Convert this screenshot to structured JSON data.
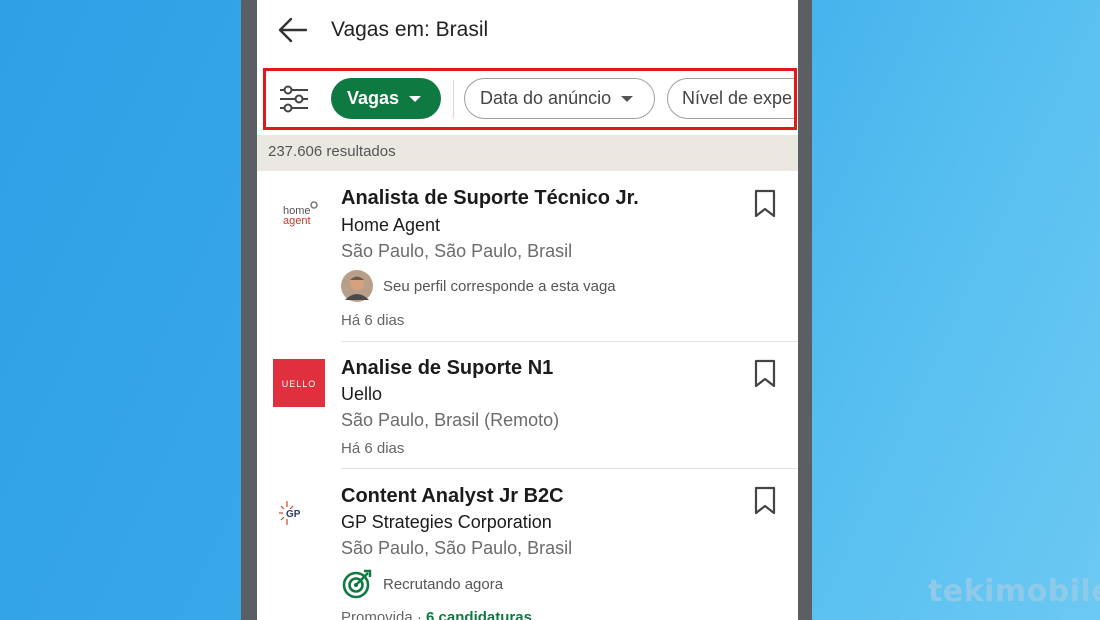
{
  "header": {
    "title": "Vagas em: Brasil"
  },
  "filters": {
    "chips": [
      "Vagas",
      "Data do anúncio",
      "Nível de expe"
    ]
  },
  "results": {
    "count_text": "237.606 resultados"
  },
  "jobs": [
    {
      "title": "Analista de Suporte Técnico Jr.",
      "company": "Home Agent",
      "location": "São Paulo, São Paulo, Brasil",
      "insight": "Seu perfil corresponde a esta vaga",
      "posted": "Há 6 dias",
      "logo_text": [
        "home",
        "agent"
      ]
    },
    {
      "title": "Analise de Suporte N1",
      "company": "Uello",
      "location": "São Paulo, Brasil (Remoto)",
      "posted": "Há 6 dias",
      "logo_text": "UELLO"
    },
    {
      "title": "Content Analyst Jr B2C",
      "company": "GP Strategies Corporation",
      "location": "São Paulo, São Paulo, Brasil",
      "insight": "Recrutando agora",
      "promoted": "Promovida",
      "applicants": "6 candidaturas",
      "logo_text": "GP"
    }
  ],
  "colors": {
    "accent_green": "#0e7a41",
    "highlight_red": "#e01a1a",
    "results_bg": "#ebe8e2"
  },
  "watermark": "tekimobile"
}
